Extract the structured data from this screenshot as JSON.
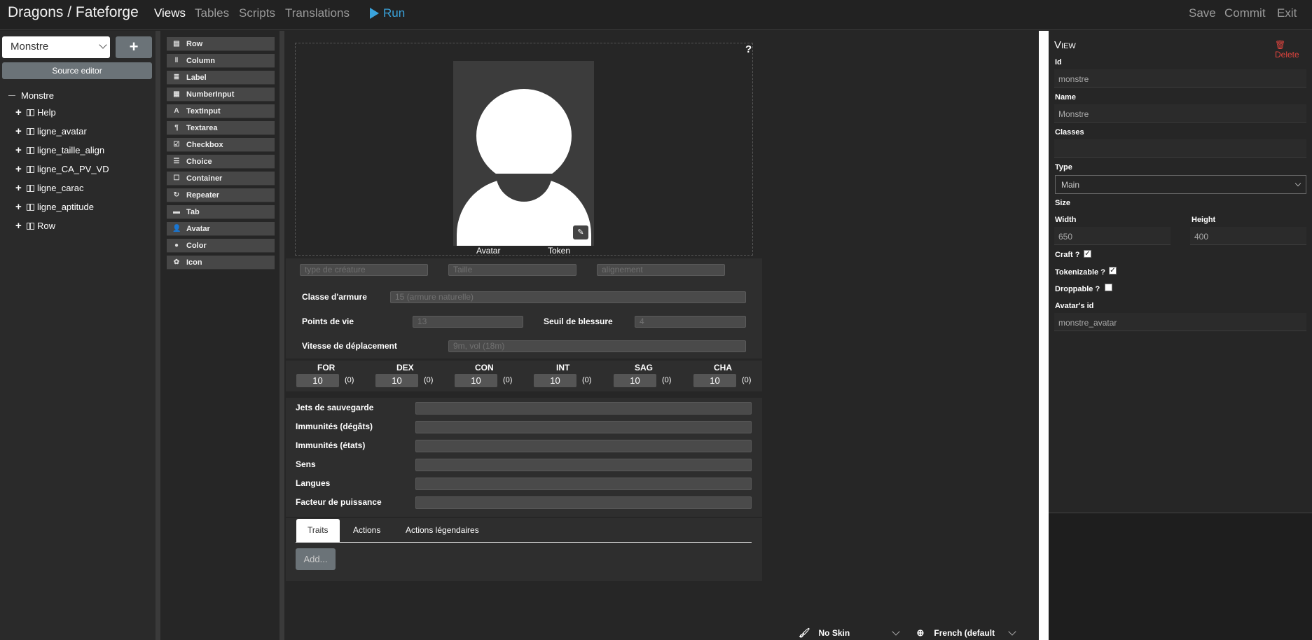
{
  "topbar": {
    "title": "Dragons / Fateforge",
    "nav": [
      "Views",
      "Tables",
      "Scripts",
      "Translations"
    ],
    "run": "Run",
    "actions": [
      "Save",
      "Commit",
      "Exit"
    ]
  },
  "left": {
    "view_select": "Monstre",
    "add": "+",
    "source_editor": "Source editor",
    "tree_root": "Monstre",
    "tree_items": [
      "Help",
      "ligne_avatar",
      "ligne_taille_align",
      "ligne_CA_PV_VD",
      "ligne_carac",
      "ligne_aptitude",
      "Row"
    ]
  },
  "components": [
    {
      "label": "Row",
      "icon": "row-icon"
    },
    {
      "label": "Column",
      "icon": "column-icon"
    },
    {
      "label": "Label",
      "icon": "label-icon"
    },
    {
      "label": "NumberInput",
      "icon": "calculator-icon"
    },
    {
      "label": "TextInput",
      "icon": "font-icon"
    },
    {
      "label": "Textarea",
      "icon": "paragraph-icon"
    },
    {
      "label": "Checkbox",
      "icon": "checkbox-icon"
    },
    {
      "label": "Choice",
      "icon": "list-icon"
    },
    {
      "label": "Container",
      "icon": "square-icon"
    },
    {
      "label": "Repeater",
      "icon": "repeat-icon"
    },
    {
      "label": "Tab",
      "icon": "tab-icon"
    },
    {
      "label": "Avatar",
      "icon": "user-icon"
    },
    {
      "label": "Color",
      "icon": "palette-icon"
    },
    {
      "label": "Icon",
      "icon": "icons-icon"
    }
  ],
  "canvas": {
    "help": "?",
    "avatar_label": "Avatar",
    "token_label": "Token",
    "placeholders": {
      "type": "type de créature",
      "taille": "Taille",
      "align": "alignement"
    },
    "ca_label": "Classe d'armure",
    "ca_value": "15  (armure naturelle)",
    "pv_label": "Points de vie",
    "pv_value": "13",
    "seuil_label": "Seuil de blessure",
    "seuil_value": "4",
    "vd_label": "Vitesse de déplacement",
    "vd_value": "9m, vol (18m)",
    "stats": [
      {
        "name": "FOR",
        "value": "10",
        "mod": "(0)"
      },
      {
        "name": "DEX",
        "value": "10",
        "mod": "(0)"
      },
      {
        "name": "CON",
        "value": "10",
        "mod": "(0)"
      },
      {
        "name": "INT",
        "value": "10",
        "mod": "(0)"
      },
      {
        "name": "SAG",
        "value": "10",
        "mod": "(0)"
      },
      {
        "name": "CHA",
        "value": "10",
        "mod": "(0)"
      }
    ],
    "aptitudes": [
      "Jets de sauvegarde",
      "Immunités (dégâts)",
      "Immunités (états)",
      "Sens",
      "Langues",
      "Facteur de puissance"
    ],
    "tabs": [
      "Traits",
      "Actions",
      "Actions légendaires"
    ],
    "add": "Add...",
    "skin": "No Skin",
    "language": "French (default"
  },
  "right": {
    "title": "View",
    "delete": "Delete",
    "id_label": "Id",
    "id_value": "monstre",
    "name_label": "Name",
    "name_value": "Monstre",
    "classes_label": "Classes",
    "type_label": "Type",
    "type_value": "Main",
    "size_label": "Size",
    "width_label": "Width",
    "width_value": "650",
    "height_label": "Height",
    "height_value": "400",
    "craft_label": "Craft ?",
    "craft_checked": true,
    "tokenizable_label": "Tokenizable ?",
    "tokenizable_checked": true,
    "droppable_label": "Droppable ?",
    "droppable_checked": false,
    "avatar_id_label": "Avatar's id",
    "avatar_id_value": "monstre_avatar"
  },
  "colors": {
    "accent": "#3aa3dc",
    "danger": "#e0443e",
    "button": "#6b7378"
  }
}
